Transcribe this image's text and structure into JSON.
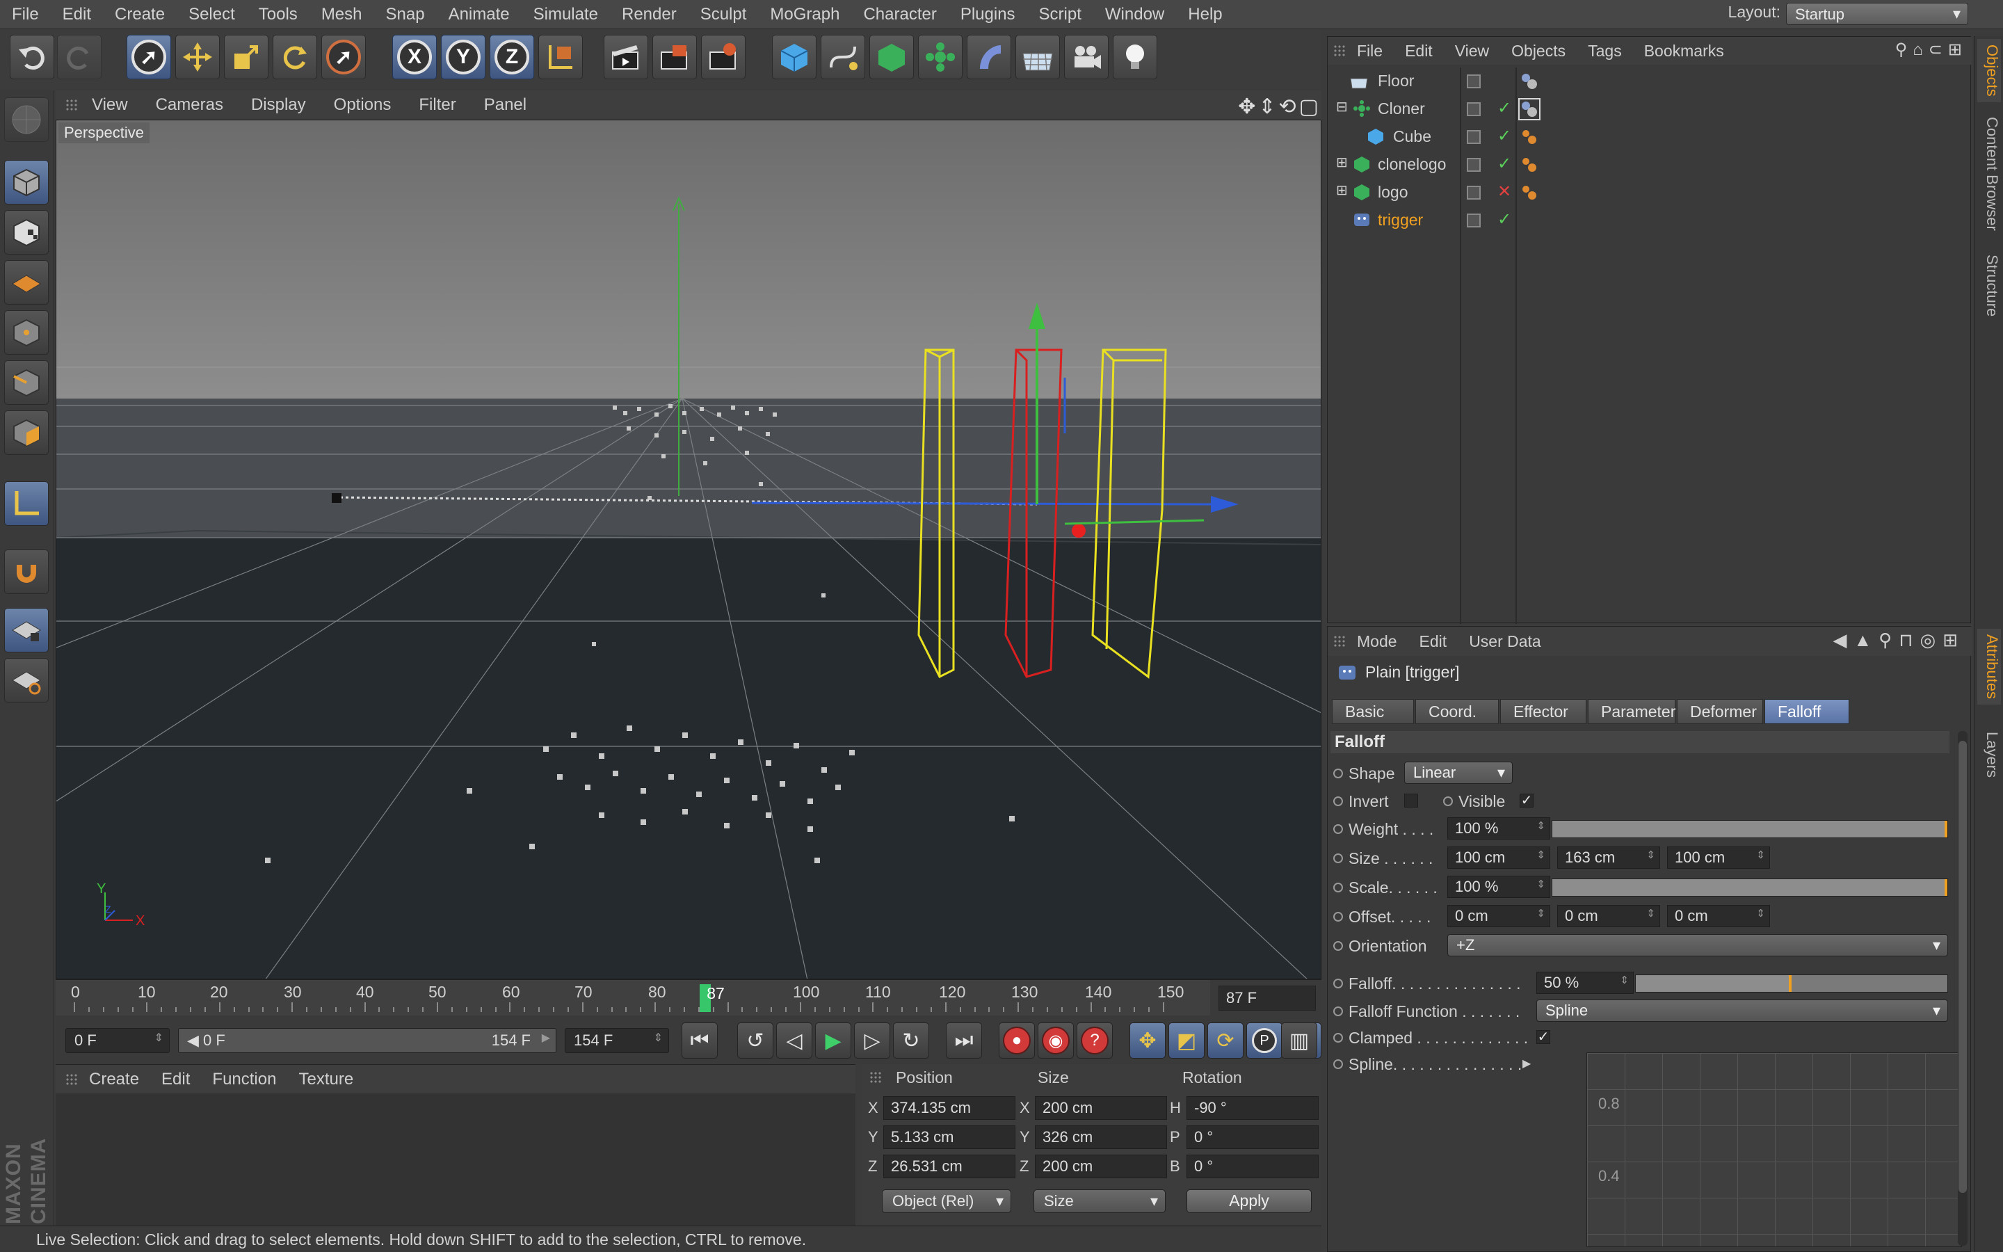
{
  "menubar": {
    "items": [
      "File",
      "Edit",
      "Create",
      "Select",
      "Tools",
      "Mesh",
      "Snap",
      "Animate",
      "Simulate",
      "Render",
      "Sculpt",
      "MoGraph",
      "Character",
      "Plugins",
      "Script",
      "Window",
      "Help"
    ],
    "layout_label": "Layout:",
    "layout_value": "Startup"
  },
  "toolbar": {
    "axis_x": "X",
    "axis_y": "Y",
    "axis_z": "Z"
  },
  "viewport": {
    "menu": [
      "View",
      "Cameras",
      "Display",
      "Options",
      "Filter",
      "Panel"
    ],
    "label": "Perspective",
    "gizmo_x": "X",
    "gizmo_y": "Y",
    "gizmo_z": "Z"
  },
  "timeline": {
    "ticks": [
      "0",
      "10",
      "20",
      "30",
      "40",
      "50",
      "60",
      "70",
      "80",
      "90",
      "100",
      "110",
      "120",
      "130",
      "140",
      "150"
    ],
    "current_label": "87",
    "current_frame": 87,
    "max_frame": 154,
    "frame_field": "87 F"
  },
  "transport": {
    "start": "0 F",
    "range_start": "0 F",
    "range_end": "154 F",
    "end": "154 F"
  },
  "material": {
    "menu": [
      "Create",
      "Edit",
      "Function",
      "Texture"
    ]
  },
  "coords": {
    "headers": {
      "position": "Position",
      "size": "Size",
      "rotation": "Rotation"
    },
    "rows": [
      {
        "axis": "X",
        "pos": "374.135 cm",
        "saxis": "X",
        "size": "200 cm",
        "raxis": "H",
        "rot": "-90 °"
      },
      {
        "axis": "Y",
        "pos": "5.133 cm",
        "saxis": "Y",
        "size": "326 cm",
        "raxis": "P",
        "rot": "0 °"
      },
      {
        "axis": "Z",
        "pos": "26.531 cm",
        "saxis": "Z",
        "size": "200 cm",
        "raxis": "B",
        "rot": "0 °"
      }
    ],
    "mode": "Object (Rel)",
    "size_mode": "Size",
    "apply": "Apply"
  },
  "status": "Live Selection: Click and drag to select elements. Hold down SHIFT to add to the selection, CTRL to remove.",
  "objects": {
    "menu": [
      "File",
      "Edit",
      "View",
      "Objects",
      "Tags",
      "Bookmarks"
    ],
    "items": [
      {
        "name": "Floor"
      },
      {
        "name": "Cloner"
      },
      {
        "name": "Cube"
      },
      {
        "name": "clonelogo"
      },
      {
        "name": "logo"
      },
      {
        "name": "trigger"
      }
    ]
  },
  "side_tabs": {
    "objects": "Objects",
    "content": "Content Browser",
    "structure": "Structure",
    "attributes": "Attributes",
    "layers": "Layers"
  },
  "attributes": {
    "menu": [
      "Mode",
      "Edit",
      "User Data"
    ],
    "title": "Plain [trigger]",
    "tabs": [
      "Basic",
      "Coord.",
      "Effector",
      "Parameter",
      "Deformer",
      "Falloff"
    ],
    "active_tab": "Falloff",
    "section": "Falloff",
    "shape_label": "Shape",
    "shape": "Linear",
    "invert_label": "Invert",
    "visible_label": "Visible",
    "weight_label": "Weight . . . .",
    "weight": "100 %",
    "weight_fraction": 1.0,
    "size_label": "Size . . . . . .",
    "size": [
      "100 cm",
      "163 cm",
      "100 cm"
    ],
    "scale_label": "Scale. . . . . .",
    "scale": "100 %",
    "scale_fraction": 1.0,
    "offset_label": "Offset. . . . .",
    "offset": [
      "0 cm",
      "0 cm",
      "0 cm"
    ],
    "orientation_label": "Orientation",
    "orientation": "+Z",
    "falloff_label": "Falloff. . . . . . . . . . . . . . .",
    "falloff": "50 %",
    "falloff_fraction": 0.5,
    "falloff_function_label": "Falloff Function . . . . . . .",
    "falloff_function": "Spline",
    "clamped_label": "Clamped . . . . . . . . . . . . .",
    "spline_label": "Spline. . . . . . . . . . . . . . .",
    "graph_labels": [
      "0.8",
      "0.4"
    ]
  },
  "colors": {
    "accent": "#f0a020",
    "selection": "#5a74a6",
    "playhead": "#38c66b"
  }
}
